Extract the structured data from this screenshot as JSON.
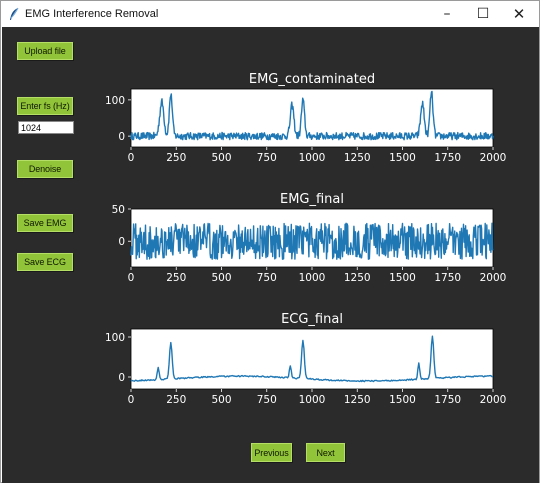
{
  "window": {
    "title": "EMG Interference Removal",
    "controls": {
      "minimize": "–",
      "maximize": "☐",
      "close": "✕"
    }
  },
  "sidebar": {
    "upload_label": "Upload file",
    "fs_label": "Enter fs (Hz)",
    "fs_value": "1024",
    "denoise_label": "Denoise",
    "save_emg_label": "Save EMG",
    "save_ecg_label": "Save ECG"
  },
  "nav": {
    "previous_label": "Previous",
    "next_label": "Next"
  },
  "colors": {
    "background": "#2b2b2b",
    "button": "#92c43a",
    "line": "#1f77b4",
    "text": "#ffffff"
  },
  "chart_data": [
    {
      "type": "line",
      "title": "EMG_contaminated",
      "xlim": [
        0,
        2000
      ],
      "ylim": [
        -30,
        130
      ],
      "xticks": [
        0,
        250,
        500,
        750,
        1000,
        1250,
        1500,
        1750,
        2000
      ],
      "yticks": [
        0,
        100
      ],
      "series": [
        {
          "description": "noisy EMG with ECG peaks near 220, 950, 1660",
          "noise_amplitude": 10,
          "peaks": [
            [
              170,
              95,
              40
            ],
            [
              220,
              115,
              30
            ],
            [
              890,
              85,
              35
            ],
            [
              950,
              100,
              30
            ],
            [
              1610,
              90,
              35
            ],
            [
              1660,
              120,
              30
            ]
          ]
        }
      ]
    },
    {
      "type": "line",
      "title": "EMG_final",
      "xlim": [
        0,
        2000
      ],
      "ylim": [
        -40,
        50
      ],
      "xticks": [
        0,
        250,
        500,
        750,
        1000,
        1250,
        1500,
        1750,
        2000
      ],
      "yticks": [
        0,
        50
      ],
      "series": [
        {
          "description": "EMG noise around zero",
          "noise_amplitude": 28,
          "peaks": []
        }
      ]
    },
    {
      "type": "line",
      "title": "ECG_final",
      "xlim": [
        0,
        2000
      ],
      "ylim": [
        -30,
        120
      ],
      "xticks": [
        0,
        250,
        500,
        750,
        1000,
        1250,
        1500,
        1750,
        2000
      ],
      "yticks": [
        0,
        100
      ],
      "series": [
        {
          "description": "clean ECG beats near 220, 950, 1660",
          "noise_amplitude": 1.5,
          "peaks": [
            [
              150,
              30,
              18
            ],
            [
              220,
              92,
              26
            ],
            [
              880,
              30,
              18
            ],
            [
              950,
              95,
              26
            ],
            [
              1590,
              40,
              18
            ],
            [
              1665,
              105,
              26
            ]
          ]
        }
      ]
    }
  ]
}
